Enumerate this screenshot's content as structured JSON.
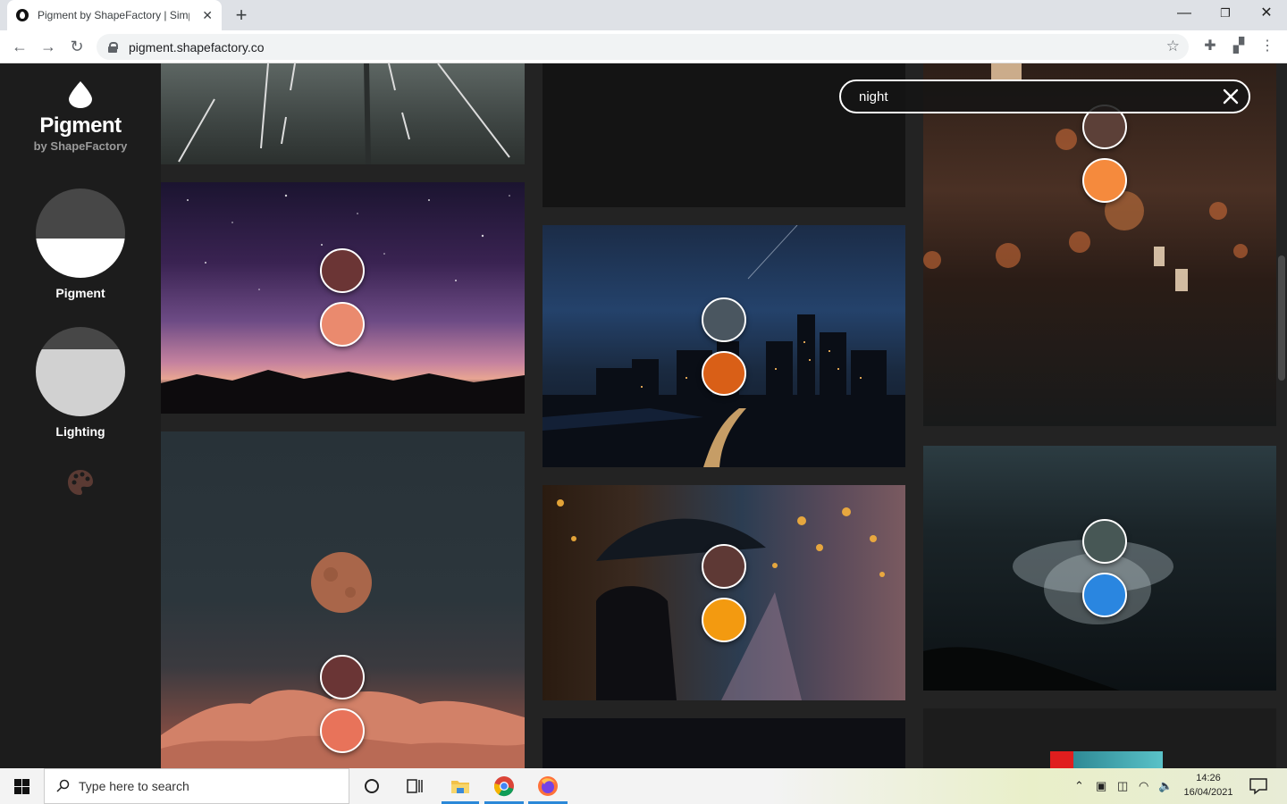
{
  "browser": {
    "tab_title": "Pigment by ShapeFactory | Simpl",
    "tab_close": "✕",
    "new_tab": "+",
    "url": "pigment.shapefactory.co",
    "min": "—",
    "max": "❐",
    "close": "✕"
  },
  "sidebar": {
    "brand": "Pigment",
    "brand_sub": "by ShapeFactory",
    "modes": [
      {
        "label": "Pigment"
      },
      {
        "label": "Lighting"
      }
    ]
  },
  "search": {
    "value": "night"
  },
  "colors": {
    "accent": "#ffffff",
    "sidebar_bg": "#1c1c1c",
    "page_bg": "#232323"
  },
  "cards": [
    {
      "col": 0,
      "desc": "road",
      "swatches": []
    },
    {
      "col": 0,
      "desc": "purple-sky",
      "swatches": [
        "#6b3535",
        "#ea8a6e"
      ]
    },
    {
      "col": 0,
      "desc": "moon",
      "swatches": [
        "#6a3535",
        "#e8735a"
      ]
    },
    {
      "col": 1,
      "desc": "dark-sky",
      "swatches": []
    },
    {
      "col": 1,
      "desc": "city",
      "swatches": [
        "#4a5660",
        "#d95f17"
      ]
    },
    {
      "col": 1,
      "desc": "umbrella",
      "swatches": [
        "#5e3935",
        "#f39a10"
      ]
    },
    {
      "col": 2,
      "desc": "bulb",
      "swatches": [
        "#5c4038",
        "#f58a3d"
      ]
    },
    {
      "col": 2,
      "desc": "sea",
      "swatches": [
        "#475755",
        "#2a86e0"
      ]
    }
  ],
  "taskbar": {
    "search_placeholder": "Type here to search",
    "time": "14:26",
    "date": "16/04/2021"
  }
}
